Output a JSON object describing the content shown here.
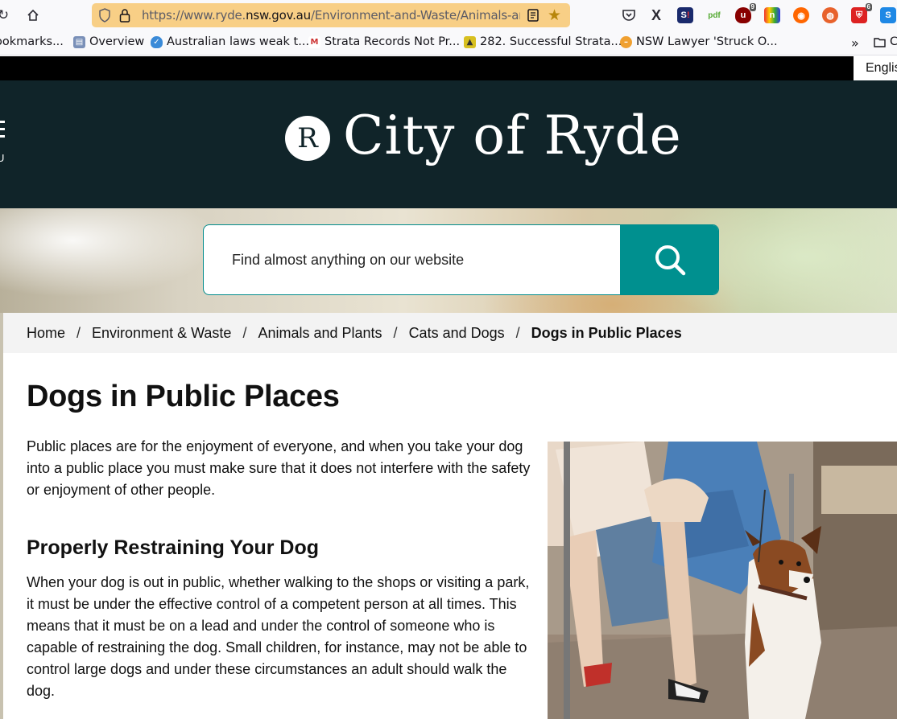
{
  "browser": {
    "url_prefix": "https://www.ryde.",
    "url_domain": "nsw.gov.au",
    "url_path": "/Environment-and-Waste/Animals-and",
    "bookmarks": [
      {
        "label": "ookmarks...",
        "icon": "folder-icon"
      },
      {
        "label": "Overview",
        "icon": "overview-icon"
      },
      {
        "label": "Australian laws weak t...",
        "icon": "shield-icon"
      },
      {
        "label": "Strata Records Not Pr...",
        "icon": "gmail-icon"
      },
      {
        "label": "282. Successful Strata...",
        "icon": "strata-icon"
      },
      {
        "label": "NSW Lawyer 'Struck O...",
        "icon": "news-icon"
      }
    ],
    "bookmarks_more": "»",
    "bookmarks_folder": "C",
    "ext_badges": {
      "ublock": "9",
      "ext6": "6"
    }
  },
  "site": {
    "language": "English",
    "menu_label": "U",
    "logo_letter": "R",
    "logo_text": "City of Ryde",
    "search_placeholder": "Find almost anything on our website"
  },
  "breadcrumb": [
    {
      "label": "Home"
    },
    {
      "label": "Environment & Waste"
    },
    {
      "label": "Animals and Plants"
    },
    {
      "label": "Cats and Dogs"
    },
    {
      "label": "Dogs in Public Places",
      "current": true
    }
  ],
  "breadcrumb_separator": "/",
  "content": {
    "title": "Dogs in Public Places",
    "intro": "Public places are for the enjoyment of everyone, and when you take your dog into a public place you must make sure that it does not interfere with the safety or enjoyment of other people.",
    "section_heading": "Properly Restraining Your Dog",
    "section_text": "When your dog is out in public, whether walking to the shops or visiting a park, it must be under the effective control of a competent person at all times. This means that it must be on a lead and under the control of someone who is capable of restraining the dog. Small children, for instance, may not be able to control large dogs and under these circumstances an adult should walk the dog."
  }
}
